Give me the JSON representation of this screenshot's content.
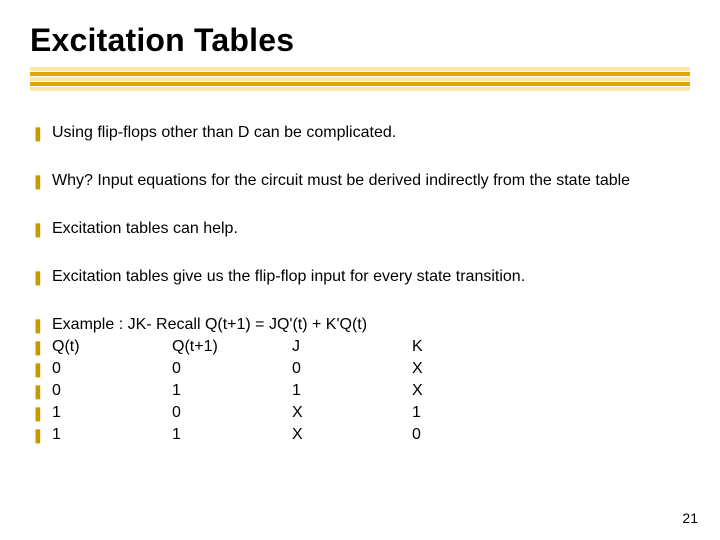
{
  "title": "Excitation Tables",
  "bullets": {
    "b1": "Using flip-flops other than D can be complicated.",
    "b2": "Why? Input equations for the circuit must be derived indirectly from the state table",
    "b3": "Excitation tables can help.",
    "b4": "Excitation tables give us the flip-flop input for every state transition.",
    "example_intro": "Example : JK- Recall Q(t+1) = JQ'(t) + K'Q(t)"
  },
  "table": {
    "headers": {
      "c0": "Q(t)",
      "c1": "Q(t+1)",
      "c2": "J",
      "c3": "K"
    },
    "rows": [
      {
        "c0": "0",
        "c1": "0",
        "c2": "0",
        "c3": "X"
      },
      {
        "c0": "0",
        "c1": "1",
        "c2": "1",
        "c3": "X"
      },
      {
        "c0": "1",
        "c1": "0",
        "c2": "X",
        "c3": "1"
      },
      {
        "c0": "1",
        "c1": "1",
        "c2": "X",
        "c3": "0"
      }
    ]
  },
  "page_number": "21",
  "glyphs": {
    "bullet": "❚"
  }
}
